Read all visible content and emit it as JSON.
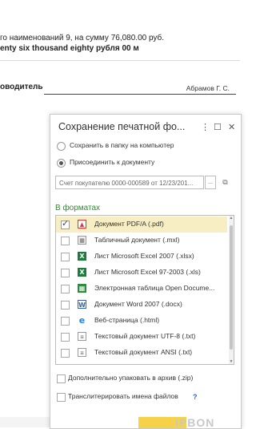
{
  "background": {
    "line1": "го наименований 9, на сумму 76,080.00 руб.",
    "line2": "enty six thousand eighty рубля 00 м",
    "signature_label": "оводитель",
    "signature_name": "Абрамов Г. С."
  },
  "dialog": {
    "title": "Сохранение печатной фо...",
    "title_buttons": {
      "more": "⋮",
      "maximize": "☐",
      "close": "✕"
    },
    "radio_save_to_folder": "Сохранить в папку на компьютер",
    "radio_attach": "Присоединить к документу",
    "selected_radio": "attach",
    "document_field": "Счет покупателю 0000-000589 от 12/23/201...",
    "document_buttons": {
      "select": "...",
      "open": "⧉"
    },
    "formats_header": "В форматах",
    "formats": [
      {
        "label": "Документ PDF/A (.pdf)",
        "icon": "pdf-icon",
        "checked": true,
        "selected": true
      },
      {
        "label": "Табличный документ (.mxl)",
        "icon": "mxl-icon",
        "checked": false,
        "selected": false
      },
      {
        "label": "Лист Microsoft Excel 2007 (.xlsx)",
        "icon": "excel-icon",
        "checked": false,
        "selected": false
      },
      {
        "label": "Лист Microsoft Excel 97-2003 (.xls)",
        "icon": "excel-icon",
        "checked": false,
        "selected": false
      },
      {
        "label": "Электронная таблица Open Docume...",
        "icon": "ods-icon",
        "checked": false,
        "selected": false
      },
      {
        "label": "Документ Word 2007 (.docx)",
        "icon": "word-icon",
        "checked": false,
        "selected": false
      },
      {
        "label": "Веб-страница (.html)",
        "icon": "html-icon",
        "checked": false,
        "selected": false
      },
      {
        "label": "Текстовый документ UTF-8 (.txt)",
        "icon": "txt-icon",
        "checked": false,
        "selected": false
      },
      {
        "label": "Текстовый документ ANSI (.txt)",
        "icon": "txt-icon",
        "checked": false,
        "selected": false
      }
    ],
    "option_zip": "Дополнительно упаковать в архив (.zip)",
    "option_transliterate": "Транслитерировать имена файлов",
    "help": "?",
    "colors": {
      "accent_green": "#2e8b2e",
      "selection": "#f7efc3",
      "button_yellow": "#f5d24a"
    }
  },
  "watermark": "IPBON"
}
